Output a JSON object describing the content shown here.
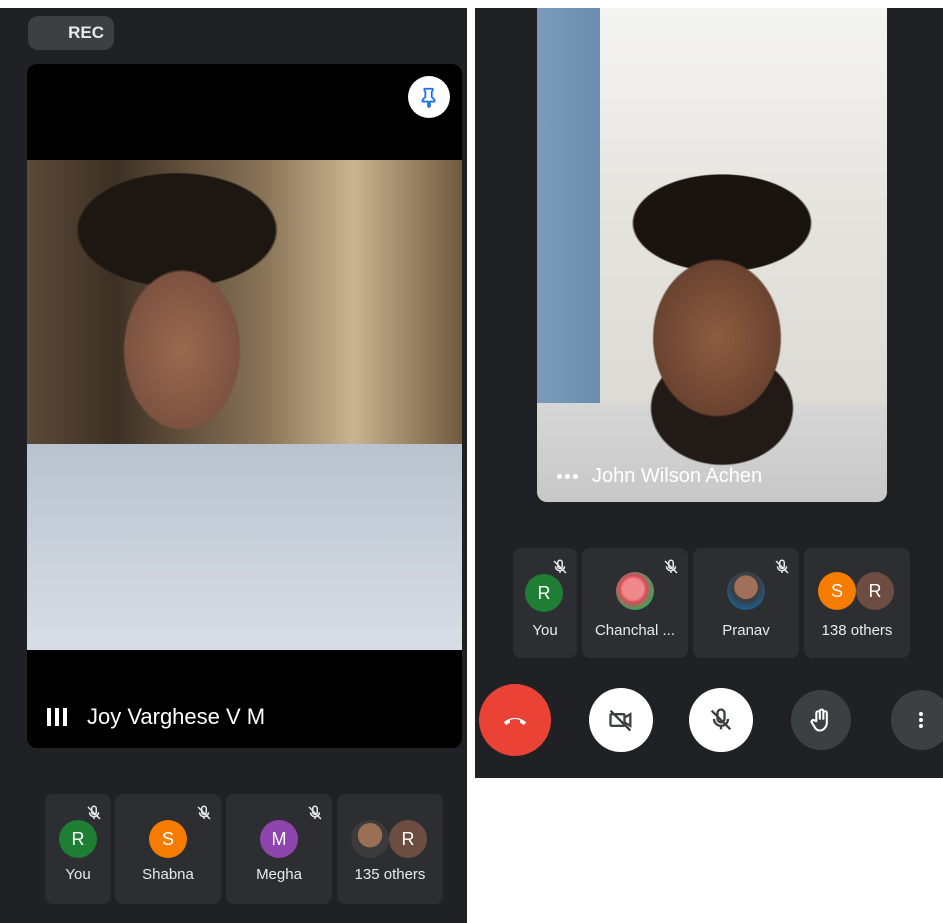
{
  "left": {
    "rec_label": "REC",
    "main_participant": "Joy Varghese V M",
    "participants": [
      {
        "initial": "R",
        "name": "You",
        "color": "#1e7e34"
      },
      {
        "initial": "S",
        "name": "Shabna",
        "color": "#f57c00"
      },
      {
        "initial": "M",
        "name": "Megha",
        "color": "#8e44ad"
      },
      {
        "initial": "R",
        "name": "135 others",
        "color": "#6d4c41"
      }
    ]
  },
  "right": {
    "main_participant": "John Wilson Achen",
    "participants": [
      {
        "initial": "R",
        "name": "You",
        "color": "#1e7e34"
      },
      {
        "name": "Chanchal ..."
      },
      {
        "name": "Pranav"
      },
      {
        "initials": [
          "S",
          "R"
        ],
        "name": "138 others",
        "colors": [
          "#f57c00",
          "#6d4c41"
        ]
      }
    ],
    "controls": [
      "end-call",
      "camera-off",
      "mic-off",
      "raise-hand",
      "more-options"
    ]
  },
  "colors": {
    "end_call": "#ea4335",
    "panel_bg": "#202124",
    "tile_bg": "#2d2e31"
  }
}
